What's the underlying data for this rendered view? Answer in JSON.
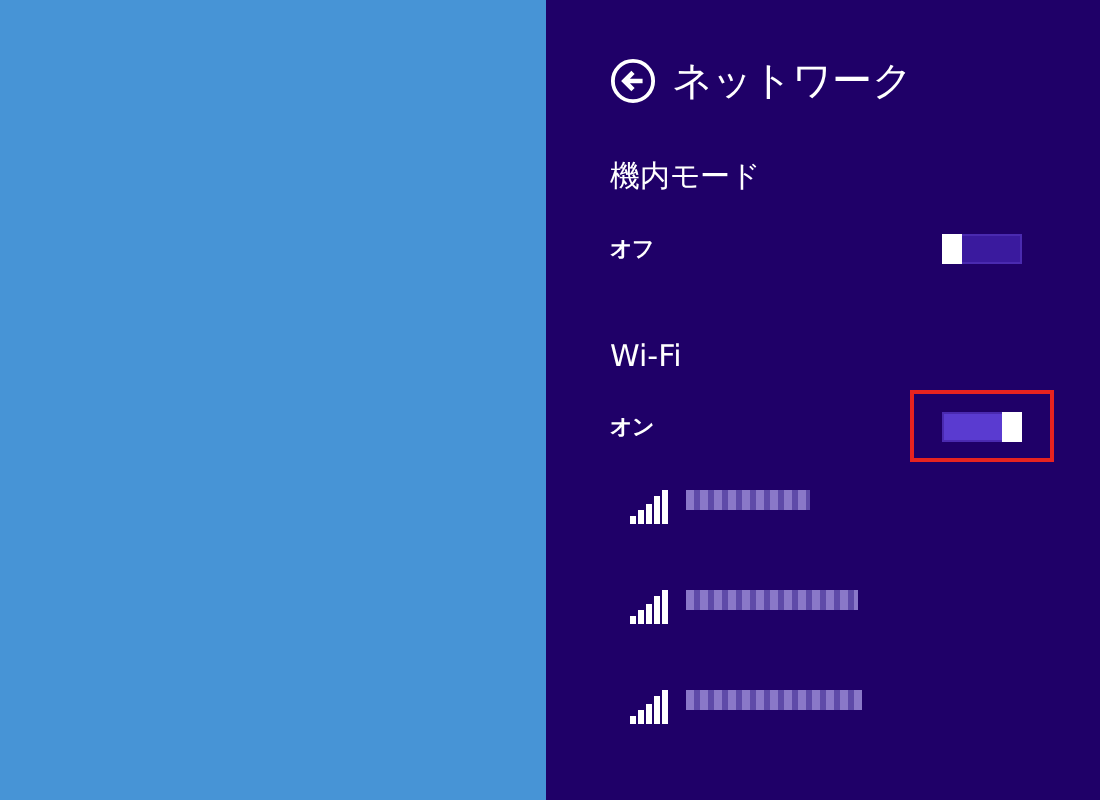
{
  "panel": {
    "title": "ネットワーク"
  },
  "settings": [
    {
      "label": "機内モード",
      "state": "オフ",
      "on": false,
      "highlighted": false
    },
    {
      "label": "Wi-Fi",
      "state": "オン",
      "on": true,
      "highlighted": true
    }
  ],
  "networks": [
    {
      "kind": "blurred"
    },
    {
      "kind": "blurred"
    },
    {
      "kind": "blurred"
    }
  ]
}
